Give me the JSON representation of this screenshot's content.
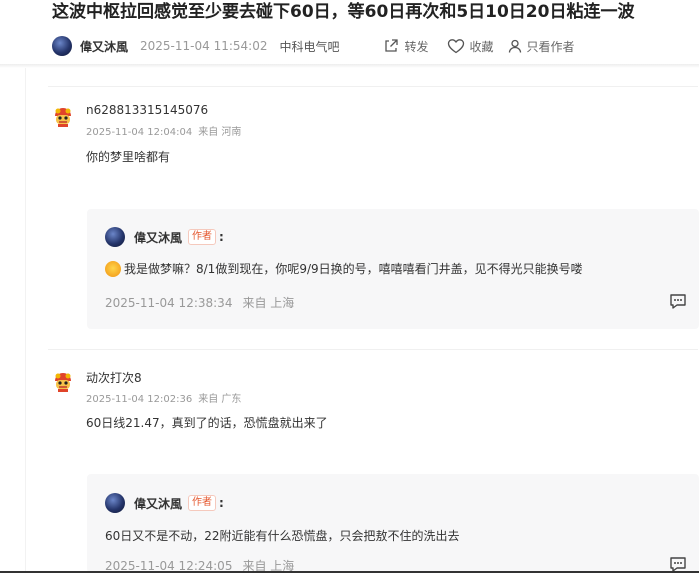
{
  "post": {
    "title": "这波中枢拉回感觉至少要去碰下60日，等60日再次和5日10日20日粘连一波",
    "author": "偉又沐風",
    "time": "2025-11-04 11:54:02",
    "bar": "中科电气吧",
    "share_label": "转发",
    "fav_label": "收藏",
    "only_author_label": "只看作者"
  },
  "comments": [
    {
      "user": "n628813315145076",
      "time": "2025-11-04 12:04:04",
      "location": "来自 河南",
      "text": "你的梦里啥都有",
      "reply": {
        "author": "偉又沐風",
        "badge": "作者",
        "colon": ":",
        "text": "我是做梦嘛？8/1做到现在，你呢9/9日换的号，嘻嘻嘻看门井盖，见不得光只能换号喽",
        "time": "2025-11-04 12:38:34",
        "location": "来自 上海"
      }
    },
    {
      "user": "动次打次8",
      "time": "2025-11-04 12:02:36",
      "location": "来自 广东",
      "text": "60日线21.47，真到了的话，恐慌盘就出来了",
      "reply": {
        "author": "偉又沐風",
        "badge": "作者",
        "colon": ":",
        "text": "60日又不是不动，22附近能有什么恐慌盘，只会把敖不住的洗出去",
        "time": "2025-11-04 12:24:05",
        "location": "来自 上海"
      }
    }
  ],
  "icons": {
    "share": "share-icon",
    "fav": "heart-icon",
    "only_author": "person-icon",
    "comment": "comment-icon",
    "user_avatar": "lion-dance-avatar",
    "emoji": "laughing-emoji"
  }
}
